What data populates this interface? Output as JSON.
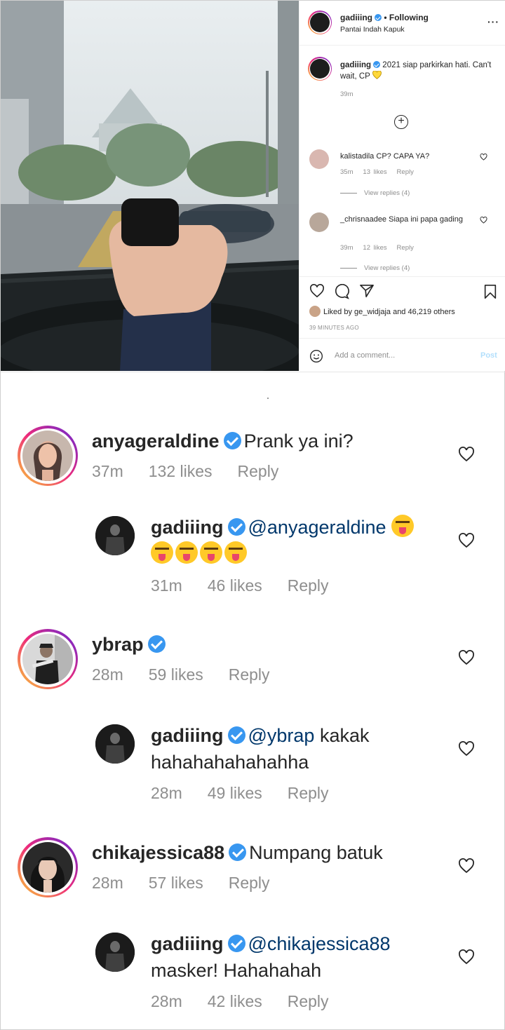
{
  "post": {
    "header": {
      "username": "gadiiing",
      "follow_state": "• Following",
      "location": "Pantai Indah Kapuk",
      "more": "···"
    },
    "caption": {
      "username": "gadiiing",
      "text": "2021 siap parkirkan hati. Can't wait, CP",
      "emoji": "yellow-heart",
      "time": "39m"
    },
    "comments": [
      {
        "username": "kalistadila",
        "text": "CP? CAPA YA?",
        "time": "35m",
        "likes": "13 likes",
        "reply": "Reply",
        "view_replies": "View replies (4)"
      },
      {
        "username": "_chrisnaadee",
        "text": "Siapa ini papa gading",
        "time": "39m",
        "likes": "12 likes",
        "reply": "Reply",
        "view_replies": "View replies (4)"
      }
    ],
    "liked_by": {
      "prefix": "Liked by ",
      "user": "ge_widjaja",
      "middle": " and ",
      "count": "46,219 others"
    },
    "time_ago": "39 MINUTES AGO",
    "add_comment_placeholder": "Add a comment...",
    "post_label": "Post"
  },
  "zoom_comments": [
    {
      "username": "anyageraldine",
      "text": "Prank ya ini?",
      "time": "37m",
      "likes": "132 likes",
      "reply": "Reply"
    },
    {
      "username": "gadiiing",
      "mention": "@anyageraldine",
      "line2": "",
      "time": "31m",
      "likes": "46 likes",
      "reply": "Reply"
    },
    {
      "username": "ybrap",
      "text": "",
      "time": "28m",
      "likes": "59 likes",
      "reply": "Reply"
    },
    {
      "username": "gadiiing",
      "mention": "@ybrap",
      "text": " kakak",
      "line2": "hahahahahahahha",
      "time": "28m",
      "likes": "49 likes",
      "reply": "Reply"
    },
    {
      "username": "chikajessica88",
      "text": "Numpang batuk",
      "time": "28m",
      "likes": "57 likes",
      "reply": "Reply"
    },
    {
      "username": "gadiiing",
      "mention": "@chikajessica88",
      "line2": "masker! Hahahahah",
      "time": "28m",
      "likes": "42 likes",
      "reply": "Reply"
    }
  ],
  "colors": {
    "verified": "#3897f0",
    "mention": "#00376b",
    "muted": "#8e8e8e",
    "post_disabled": "#b2dffc"
  }
}
